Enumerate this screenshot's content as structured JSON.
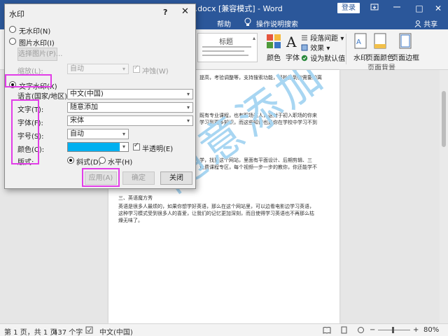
{
  "window": {
    "doc_title": "PPT.docx [兼容模式] - Word",
    "login_label": "登录",
    "restore_symbol": "□",
    "close_symbol": "✕"
  },
  "ribbon_tabs": {
    "help": "帮助",
    "tell_me": "操作说明搜索",
    "share": "共享"
  },
  "ribbon": {
    "styles_title": "标题",
    "colors_label": "颜色",
    "fonts_label": "字体",
    "paragraph_spacing": "段落间距",
    "effects": "效果",
    "set_default": "设为默认值",
    "watermark": "水印",
    "page_color": "页面颜色",
    "page_borders": "页面边框",
    "group_page_background": "页面背景"
  },
  "document": {
    "line1": "提高，考验调整等，支持搜索功能，轻松找到你需要的离",
    "line2": "既有专业课程，也有职场达人，这对于初入职场的你来",
    "line3": "学习到更多知识，而这些知识也是你在学校中学习不到",
    "line4": "学，找到这个网站，里面有平面设计、后期剪辑、三",
    "line5": "免费课程专区，每个视频一步一步的教你，你还能学不",
    "section_heading": "三、英语魔方秀",
    "para_a": "英语是很多人最烦的，如果你想学好英语，那么在这个网站里，可以边看电影边学习英语，",
    "para_b": "这种学习模式受到很多人的喜爱，让我们的记忆更加深刻，而且使得学习英语也不再那么枯",
    "para_c": "燥无味了。",
    "watermark_text": "随意添加"
  },
  "statusbar": {
    "page": "第 1 页，共 1 页",
    "words": "437 个字",
    "language": "中文(中国)",
    "zoom": "80%",
    "minus": "−",
    "plus": "+"
  },
  "dialog": {
    "title": "水印",
    "help": "?",
    "close": "✕",
    "no_watermark": "无水印(N)",
    "picture_watermark": "图片水印(I)",
    "select_picture": "选择图片(P)...",
    "scale_label": "缩放(L):",
    "scale_value": "自动",
    "washout": "冲蚀(W)",
    "text_watermark": "文字水印(X)",
    "language_label": "语言(国家/地区)(L):",
    "language_value": "中文(中国)",
    "text_label": "文字(T):",
    "text_value": "随意添加",
    "font_label": "字体(F):",
    "font_value": "宋体",
    "size_label": "字号(S):",
    "size_value": "自动",
    "color_label": "颜色(C):",
    "color_hex": "#00b0f0",
    "semitransparent": "半透明(E)",
    "layout_label": "版式:",
    "diagonal": "斜式(D)",
    "horizontal": "水平(H)",
    "apply": "应用(A)",
    "ok": "确定",
    "cancel_close": "关闭"
  }
}
